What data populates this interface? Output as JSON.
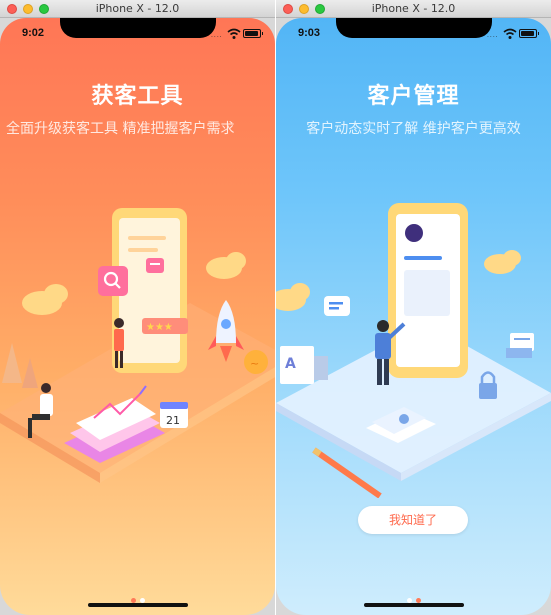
{
  "windows": [
    {
      "title": "iPhone X - 12.0",
      "status_time": "9:02",
      "onboarding": {
        "title": "获客工具",
        "subtitle": "全面升级获客工具  精准把握客户需求",
        "active_page": 0,
        "page_count": 2
      },
      "calendar_number": "21",
      "theme": {
        "gradient_top": "#ff7656",
        "gradient_bottom": "#ffdb9a"
      }
    },
    {
      "title": "iPhone X - 12.0",
      "status_time": "9:03",
      "onboarding": {
        "title": "客户管理",
        "subtitle": "客户动态实时了解  维护客户更高效",
        "active_page": 1,
        "page_count": 2
      },
      "doc_letter": "A",
      "dismiss_button": "我知道了",
      "theme": {
        "gradient_top": "#52b5f6",
        "gradient_bottom": "#cfedfd"
      }
    }
  ]
}
